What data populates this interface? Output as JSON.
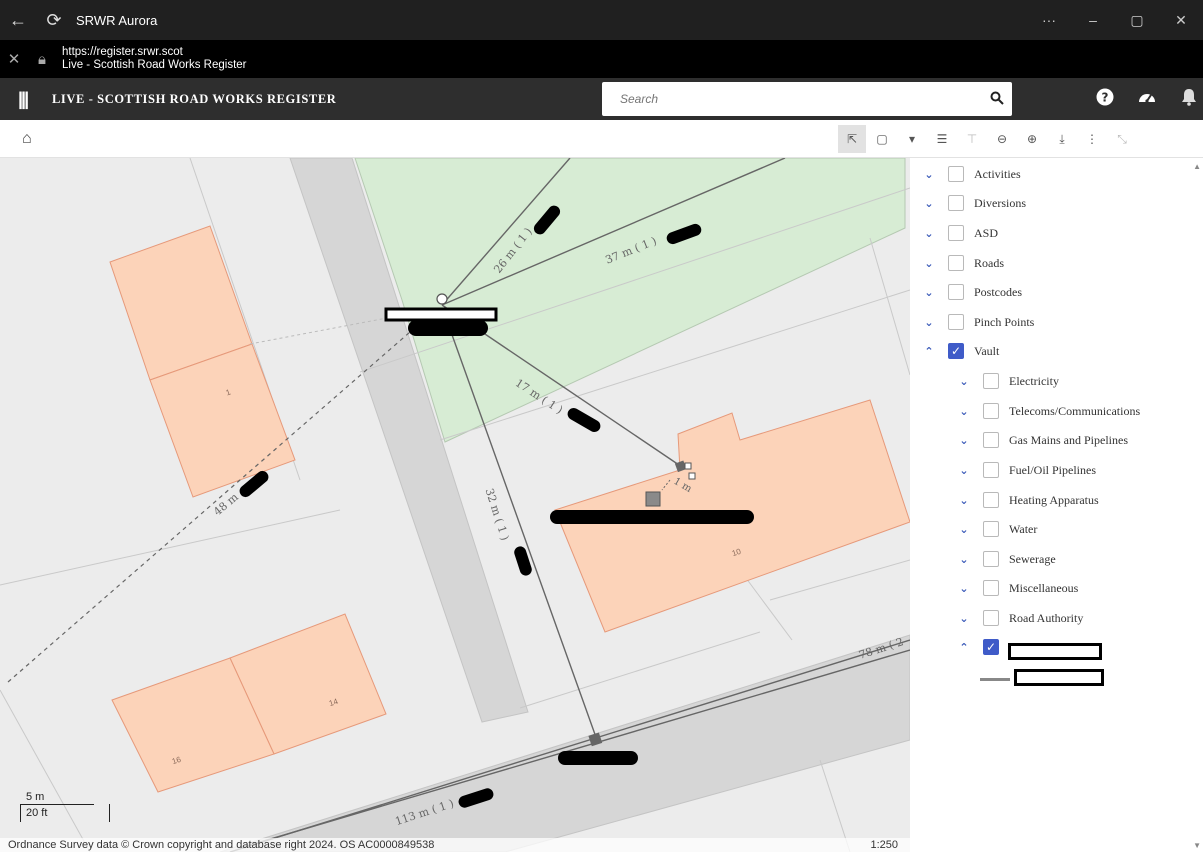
{
  "window": {
    "title": "SRWR Aurora",
    "controls": [
      "···",
      "–",
      "▢",
      "✕"
    ]
  },
  "address": {
    "url": "https://register.srwr.scot",
    "page_title": "Live - Scottish Road Works Register"
  },
  "header": {
    "app_name": "LIVE - SCOTTISH ROAD WORKS REGISTER",
    "search_placeholder": "Search"
  },
  "map": {
    "measure_labels": [
      "26 m ( 1 )",
      "37 m ( 1 )",
      "17 m ( 1 )",
      "32 m ( 1 )",
      "48 m",
      "1 m",
      "78 m ( 2",
      "113 m ( 1 )"
    ],
    "building_numbers": [
      "1",
      "10",
      "14",
      "16"
    ],
    "scale_bar": {
      "metric": "5 m",
      "imperial": "20 ft"
    },
    "attribution": "Ordnance Survey data © Crown copyright and database right 2024. OS AC0000849538",
    "scale_ratio": "1:250",
    "colors": {
      "building": "#fcd3b9",
      "park": "#d7ecd4",
      "road": "#d6d6d6",
      "background": "#ececec"
    }
  },
  "layers": {
    "items": [
      {
        "label": "Activities",
        "checked": false,
        "expanded": false
      },
      {
        "label": "Diversions",
        "checked": false,
        "expanded": false
      },
      {
        "label": "ASD",
        "checked": false,
        "expanded": false
      },
      {
        "label": "Roads",
        "checked": false,
        "expanded": false
      },
      {
        "label": "Postcodes",
        "checked": false,
        "expanded": false
      },
      {
        "label": "Pinch Points",
        "checked": false,
        "expanded": false
      },
      {
        "label": "Vault",
        "checked": true,
        "expanded": true
      }
    ],
    "vault_items": [
      {
        "label": "Electricity",
        "checked": false
      },
      {
        "label": "Telecoms/Communications",
        "checked": false
      },
      {
        "label": "Gas Mains and Pipelines",
        "checked": false
      },
      {
        "label": "Fuel/Oil Pipelines",
        "checked": false
      },
      {
        "label": "Heating Apparatus",
        "checked": false
      },
      {
        "label": "Water",
        "checked": false
      },
      {
        "label": "Sewerage",
        "checked": false
      },
      {
        "label": "Miscellaneous",
        "checked": false
      },
      {
        "label": "Road Authority",
        "checked": false
      }
    ]
  }
}
